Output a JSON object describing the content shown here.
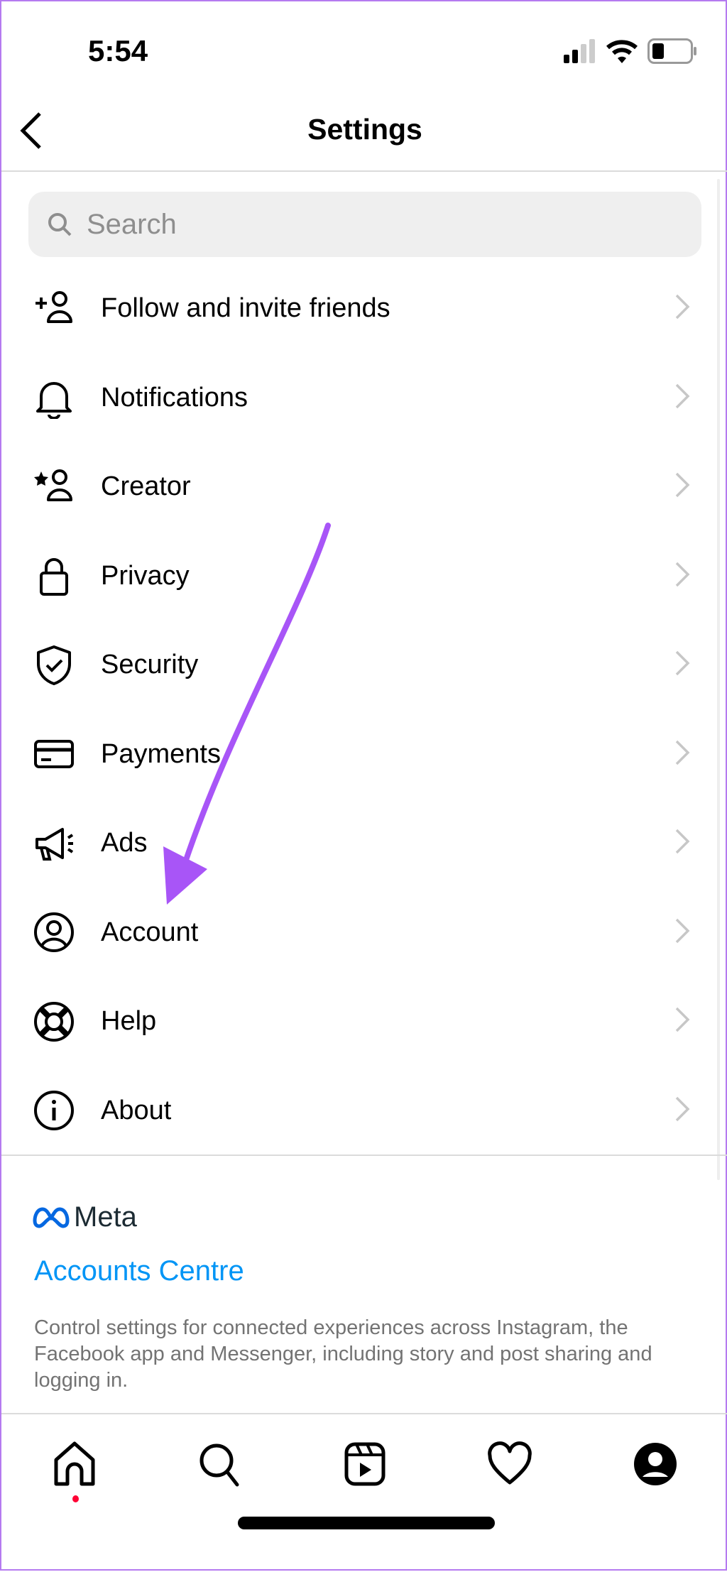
{
  "status_bar": {
    "time": "5:54",
    "signal_bars": 2,
    "battery_level": 0.25
  },
  "header": {
    "title": "Settings"
  },
  "search": {
    "placeholder": "Search",
    "value": ""
  },
  "menu": [
    {
      "label": "Follow and invite friends",
      "icon": "add-person-icon"
    },
    {
      "label": "Notifications",
      "icon": "bell-icon"
    },
    {
      "label": "Creator",
      "icon": "star-person-icon"
    },
    {
      "label": "Privacy",
      "icon": "lock-icon"
    },
    {
      "label": "Security",
      "icon": "shield-icon"
    },
    {
      "label": "Payments",
      "icon": "card-icon"
    },
    {
      "label": "Ads",
      "icon": "megaphone-icon"
    },
    {
      "label": "Account",
      "icon": "person-circle-icon"
    },
    {
      "label": "Help",
      "icon": "lifebuoy-icon"
    },
    {
      "label": "About",
      "icon": "info-icon"
    }
  ],
  "meta": {
    "logo_text": "Meta",
    "accounts_centre": "Accounts Centre",
    "description": "Control settings for connected experiences across Instagram, the Facebook app and Messenger, including story and post sharing and logging in."
  },
  "bottom_nav": [
    "home-icon",
    "search-icon",
    "reels-icon",
    "heart-icon",
    "profile-icon"
  ],
  "colors": {
    "link": "#0095f6",
    "annotation_arrow": "#a855f7",
    "notification_dot": "#ff0034"
  }
}
